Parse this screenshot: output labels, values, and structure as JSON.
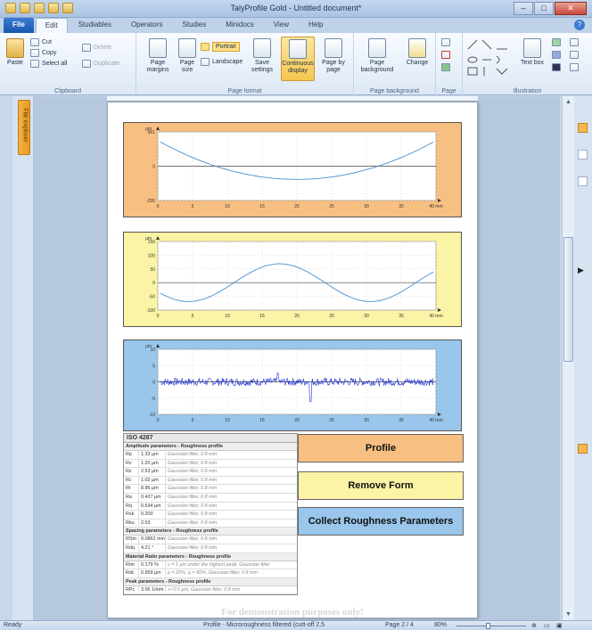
{
  "window": {
    "title": "TalyProfile Gold - Untitled document*",
    "controls": [
      "–",
      "□",
      "✕"
    ]
  },
  "tabs": [
    "File",
    "Edit",
    "Studiables",
    "Operators",
    "Studies",
    "Minidocs",
    "View",
    "Help"
  ],
  "active_tab": "Edit",
  "ribbon": {
    "clipboard": {
      "paste": "Paste",
      "cut": "Cut",
      "copy": "Copy",
      "select_all": "Select all",
      "delete": "Delete",
      "duplicate": "Duplicate",
      "label": "Clipboard"
    },
    "page_format": {
      "page_margins": "Page margins",
      "page_size": "Page size",
      "portrait": "Portrait",
      "landscape": "Landscape",
      "save_settings": "Save settings",
      "continuous_display": "Continuous display",
      "page_by_page": "Page by page",
      "label": "Page format"
    },
    "page_background": {
      "page_background": "Page background",
      "change": "Change",
      "label": "Page background"
    },
    "page": {
      "label": "Page"
    },
    "illustration": {
      "text_box": "Text box",
      "label": "Illustration"
    }
  },
  "side_panel": {
    "file_explorer": "File explorer"
  },
  "document": {
    "charts": [
      {
        "name": "primary-profile-chart",
        "unit": "µm",
        "x_unit": "mm",
        "x_ticks": [
          "0",
          "5",
          "10",
          "15",
          "20",
          "25",
          "30",
          "35",
          "40 mm"
        ],
        "y_ticks": [
          "661",
          "0",
          "-235"
        ],
        "background": "#f8bf82",
        "line_color": "#4a8ec9"
      },
      {
        "name": "form-removed-chart",
        "unit": "µm",
        "x_unit": "mm",
        "x_ticks": [
          "0",
          "5",
          "10",
          "15",
          "20",
          "25",
          "30",
          "35",
          "40 mm"
        ],
        "y_ticks": [
          "150",
          "100",
          "50",
          "0",
          "-50",
          "-100"
        ],
        "background": "#fbf3a5",
        "line_color": "#4a8ec9"
      },
      {
        "name": "roughness-chart",
        "unit": "µm",
        "x_unit": "mm",
        "x_ticks": [
          "0",
          "5",
          "10",
          "15",
          "20",
          "25",
          "30",
          "35",
          "40 mm"
        ],
        "y_ticks": [
          "10",
          "5",
          "0",
          "-5",
          "-10"
        ],
        "background": "#99c6ea",
        "line_color": "#1a2fd0"
      }
    ],
    "iso_table": {
      "title": "ISO 4287",
      "sections": [
        {
          "title": "Amplitude parameters - Roughness profile",
          "rows": [
            [
              "Rp",
              "1.33 µm",
              "Gaussian filter, 0.8 mm"
            ],
            [
              "Rv",
              "1.20 µm",
              "Gaussian filter, 0.8 mm"
            ],
            [
              "Rz",
              "2.53 µm",
              "Gaussian filter, 0.8 mm"
            ],
            [
              "Rc",
              "1.02 µm",
              "Gaussian filter, 0.8 mm"
            ],
            [
              "Rt",
              "8.86 µm",
              "Gaussian filter, 0.8 mm"
            ],
            [
              "Ra",
              "0.427 µm",
              "Gaussian filter, 0.8 mm"
            ],
            [
              "Rq",
              "0.534 µm",
              "Gaussian filter, 0.8 mm"
            ],
            [
              "Rsk",
              "0.200",
              "Gaussian filter, 0.8 mm"
            ],
            [
              "Rku",
              "2.53",
              "Gaussian filter, 0.8 mm"
            ]
          ]
        },
        {
          "title": "Spacing parameters - Roughness profile",
          "rows": [
            [
              "RSm",
              "0.0862 mm",
              "Gaussian filter, 0.8 mm"
            ],
            [
              "Rdq",
              "4.21 °",
              "Gaussian filter, 0.8 mm"
            ]
          ]
        },
        {
          "title": "Material Ratio parameters - Roughness profile",
          "rows": [
            [
              "Rmr",
              "0.179 %",
              "c = 1 µm under the highest peak, Gaussian filter"
            ],
            [
              "Rdc",
              "0.959 µm",
              "p = 20%, q = 80%, Gaussian filter, 0.8 mm"
            ]
          ]
        },
        {
          "title": "Peak parameters - Roughness profile",
          "rows": [
            [
              "RPc",
              "3.06 1/mm",
              "+/-0.5 µm, Gaussian filter, 0.8 mm"
            ]
          ]
        }
      ]
    },
    "buttons": {
      "profile": "Profile",
      "remove_form": "Remove Form",
      "collect": "Collect Roughness Parameters"
    },
    "watermark": "For demonstration purposes only!"
  },
  "statusbar": {
    "ready": "Ready",
    "description": "Profile - Microroughness filtered (cutt-off 2.5",
    "page": "Page 2 / 4",
    "zoom": "80%"
  },
  "colors": {
    "orange": "#f8bf82",
    "yellow": "#fbf3a5",
    "blue": "#99c6ea"
  }
}
